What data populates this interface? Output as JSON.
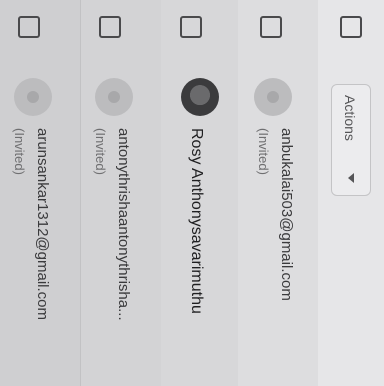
{
  "header": {
    "actions_label": "Actions"
  },
  "members": [
    {
      "name": "anbukalai503@gmail.com",
      "status": "(Invited)"
    },
    {
      "name": "Rosy Anthonysavarimuthu",
      "status": ""
    },
    {
      "name": "antonythrishaantonythrisha...",
      "status": "(Invited)"
    },
    {
      "name": "arunsankar1312@gmail.com",
      "status": "(Invited)"
    }
  ]
}
